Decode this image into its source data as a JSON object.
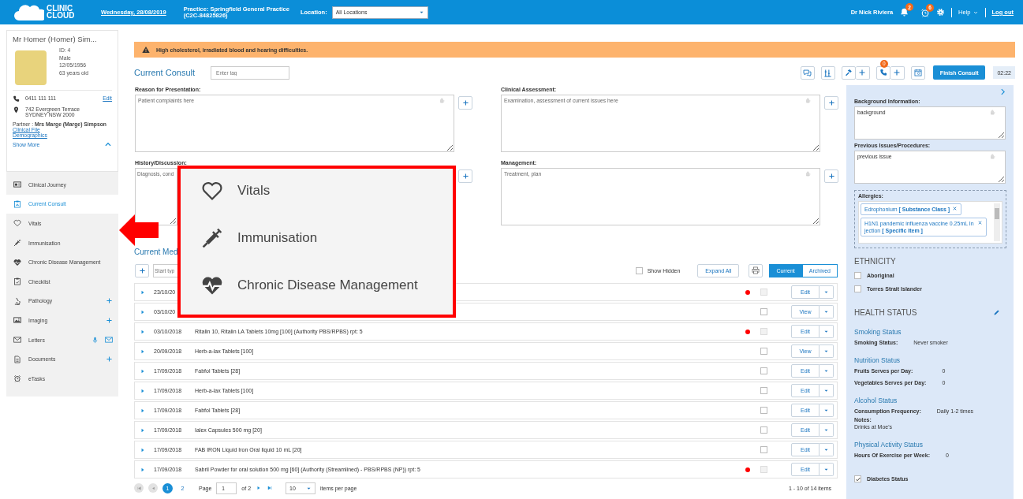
{
  "topbar": {
    "logo_lines": [
      "CLINIC",
      "CLOUD"
    ],
    "date": "Wednesday, 28/08/2019",
    "practice_lines": [
      "Practice: Springfield General Practice",
      "(C2C-84825826)"
    ],
    "location_label": "Location:",
    "location_value": "All Locations",
    "user": "Dr Nick Riviera",
    "notifications_badge": "2",
    "reminders_badge": "6",
    "help": "Help",
    "logout": "Log out"
  },
  "patient": {
    "name": "Mr Homer (Homer) Sim...",
    "details": [
      "ID: 4",
      "Male",
      "12/05/1956",
      "63 years old"
    ],
    "phone": "0411 111 111",
    "edit": "Edit",
    "address_lines": [
      "742 Evergreen Terrace",
      "SYDNEY NSW 2000"
    ],
    "partner": "Partner : **Mrs Marge (Marge) Simpson**",
    "links": [
      "Clinical File",
      "Demographics"
    ],
    "show_more": "Show More"
  },
  "nav": [
    {
      "label": "Clinical Journey",
      "kind": "plain",
      "selected": false
    },
    {
      "label": "Current Consult",
      "kind": "plain",
      "selected": true
    },
    {
      "label": "Vitals",
      "kind": "plain",
      "selected": false
    },
    {
      "label": "Immunisation",
      "kind": "plain",
      "selected": false
    },
    {
      "label": "Chronic Disease Management",
      "kind": "plain",
      "selected": false
    },
    {
      "label": "Checklist",
      "kind": "plain",
      "selected": false
    },
    {
      "label": "Pathology",
      "kind": "add",
      "selected": false
    },
    {
      "label": "Imaging",
      "kind": "add",
      "selected": false
    },
    {
      "label": "Letters",
      "kind": "letters",
      "selected": false
    },
    {
      "label": "Documents",
      "kind": "add",
      "selected": false
    },
    {
      "label": "eTasks",
      "kind": "plain",
      "selected": false
    }
  ],
  "alert": "High cholesterol, irradiated blood and hearing difficulties.",
  "consult": {
    "title": "Current Consult",
    "tag_placeholder": "Enter tag",
    "call_badge": "0",
    "finish": "Finish Consult",
    "timer": "02:22"
  },
  "notes": [
    {
      "label": "Reason for Presentation:",
      "placeholder": "Patient complaints here"
    },
    {
      "label": "Clinical Assessment:",
      "placeholder": "Examination, assessment of current issues here"
    },
    {
      "label": "History/Discussion:",
      "placeholder": "Diagnosis, cond"
    },
    {
      "label": "Management:",
      "placeholder": "Treatment, plan"
    }
  ],
  "medications": {
    "title": "Current Med",
    "search_placeholder": "Start typ",
    "show_hidden": {
      "label": "Show Hidden",
      "checked": false
    },
    "expand_all": "Expand All",
    "views": [
      {
        "label": "Current",
        "selected": true
      },
      {
        "label": "Archived",
        "selected": false
      }
    ],
    "rows": [
      {
        "date": "23/10/20",
        "flagged": true,
        "checked": false,
        "disabled": true,
        "action": "Edit"
      },
      {
        "date": "03/10/20",
        "flagged": false,
        "checked": false,
        "disabled": false,
        "action": "View"
      },
      {
        "date": "03/10/2018",
        "description": "Ritalin 10, Ritalin LA Tablets 10mg [100] (Authority PBS/RPBS) rpt: 5",
        "flagged": true,
        "checked": false,
        "disabled": true,
        "action": "Edit"
      },
      {
        "date": "20/09/2018",
        "description": "Herb-a-lax Tablets [100]",
        "flagged": false,
        "checked": false,
        "disabled": false,
        "action": "View"
      },
      {
        "date": "17/09/2018",
        "description": "Fabfol Tablets [28]",
        "flagged": false,
        "checked": false,
        "disabled": false,
        "action": "Edit"
      },
      {
        "date": "17/09/2018",
        "description": "Herb-a-lax Tablets [100]",
        "flagged": false,
        "checked": false,
        "disabled": false,
        "action": "Edit"
      },
      {
        "date": "17/09/2018",
        "description": "Fabfol Tablets [28]",
        "flagged": false,
        "checked": false,
        "disabled": false,
        "action": "Edit"
      },
      {
        "date": "17/09/2018",
        "description": "Ialex Capsules 500 mg [20]",
        "flagged": false,
        "checked": false,
        "disabled": false,
        "action": "Edit"
      },
      {
        "date": "17/09/2018",
        "description": "FAB IRON Liquid Iron Oral liquid 10 mL [20]",
        "flagged": false,
        "checked": false,
        "disabled": false,
        "action": "Edit"
      },
      {
        "date": "17/09/2018",
        "description": "Sabril Powder for oral solution 500 mg [60] (Authority (Streamlined) - PBS/RPBS (NP)) rpt: 5",
        "flagged": true,
        "checked": false,
        "disabled": true,
        "action": "Edit"
      }
    ]
  },
  "pager": {
    "pages": [
      {
        "label": "1",
        "selected": true
      },
      {
        "label": "2",
        "selected": false
      }
    ],
    "page_label": "Page",
    "page_value": "1",
    "of": "of 2",
    "per_page": "10",
    "per_page_label": "items per page",
    "summary": "1 - 10 of 14 items"
  },
  "side_notes": [
    {
      "label": "Background Information:",
      "value": "background"
    },
    {
      "label": "Previous Issues/Procedures:",
      "value": "previous issue"
    }
  ],
  "allergies": {
    "label": "Allergies:",
    "items": [
      "Edrophonium **[ Substance Class ]**",
      "H1N1 pandemic influenza vaccine 0.25mL Injection **[ Specific Item ]**"
    ]
  },
  "ethnicity": {
    "title": "ETHNICITY",
    "options": [
      {
        "label": "Aboriginal",
        "checked": false
      },
      {
        "label": "Torres Strait Islander",
        "checked": false
      }
    ]
  },
  "health": {
    "title": "HEALTH STATUS",
    "sections": [
      {
        "title": "Smoking Status",
        "fields": [
          {
            "label": "Smoking Status:",
            "value": "Never smoker"
          }
        ]
      },
      {
        "title": "Nutrition Status",
        "fields": [
          {
            "label": "Fruits Serves per Day:",
            "value": "0"
          },
          {
            "label": "Vegetables Serves per Day:",
            "value": "0"
          }
        ]
      },
      {
        "title": "Alcohol Status",
        "fields": [
          {
            "label": "Consumption Frequency:",
            "value": "Daily 1-2 times"
          }
        ],
        "notes_label": "Notes:",
        "notes": "Drinks at Moe's"
      },
      {
        "title": "Physical Activity Status",
        "fields": [
          {
            "label": "Hours Of Exercise per Week:",
            "value": "0"
          }
        ]
      }
    ],
    "diabetes": {
      "label": "Diabetes Status",
      "checked": true
    }
  },
  "callout": {
    "items": [
      "Vitals",
      "Immunisation",
      "Chronic Disease Management"
    ]
  }
}
